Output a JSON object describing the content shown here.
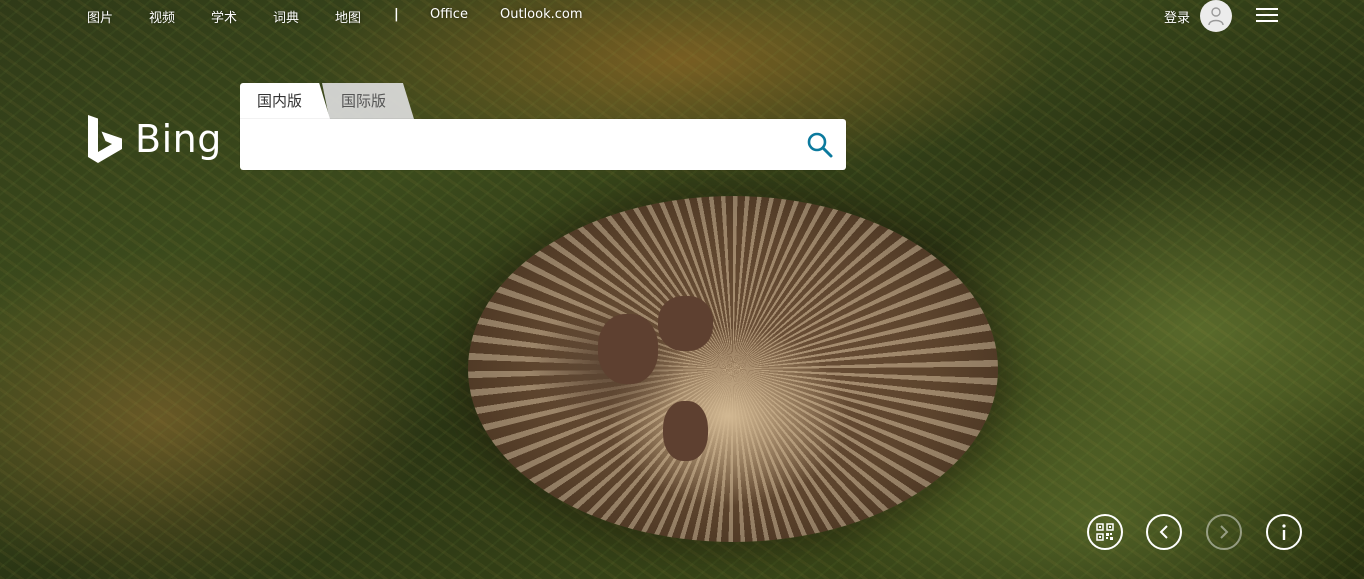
{
  "nav": {
    "links": [
      "图片",
      "视频",
      "学术",
      "词典",
      "地图"
    ],
    "separator": "|",
    "office": "Office",
    "outlook": "Outlook.com",
    "login": "登录"
  },
  "logo": {
    "text": "Bing"
  },
  "tabs": {
    "domestic": "国内版",
    "international": "国际版",
    "active": "domestic"
  },
  "search": {
    "value": "",
    "placeholder": ""
  },
  "colors": {
    "search_icon": "#0c7a9e",
    "text_white": "#ffffff"
  },
  "icons": {
    "qr": "qr-code-icon",
    "prev": "chevron-left-icon",
    "next": "chevron-right-icon",
    "info": "info-icon",
    "user": "user-icon",
    "menu": "hamburger-menu-icon",
    "search": "search-icon"
  },
  "controls": {
    "next_disabled": true
  }
}
